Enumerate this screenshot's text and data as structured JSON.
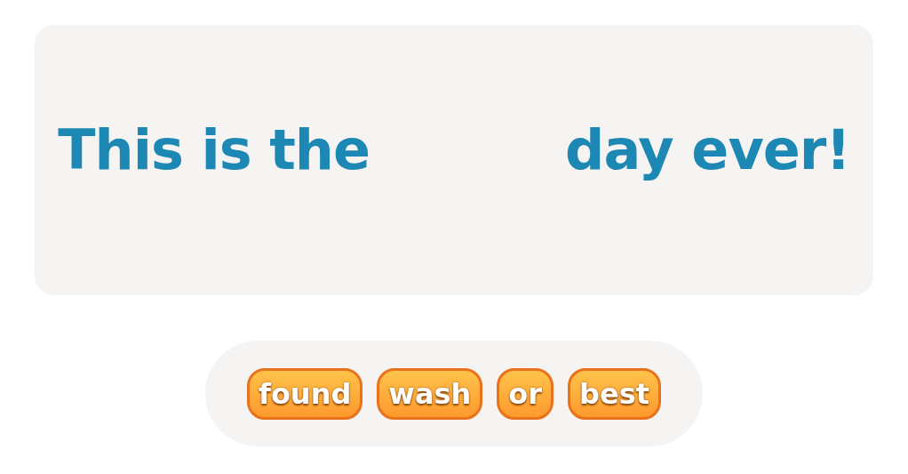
{
  "sentence": {
    "before": "This is the",
    "after": "day ever!"
  },
  "word_choices": [
    {
      "label": "found"
    },
    {
      "label": "wash"
    },
    {
      "label": "or"
    },
    {
      "label": "best"
    }
  ]
}
